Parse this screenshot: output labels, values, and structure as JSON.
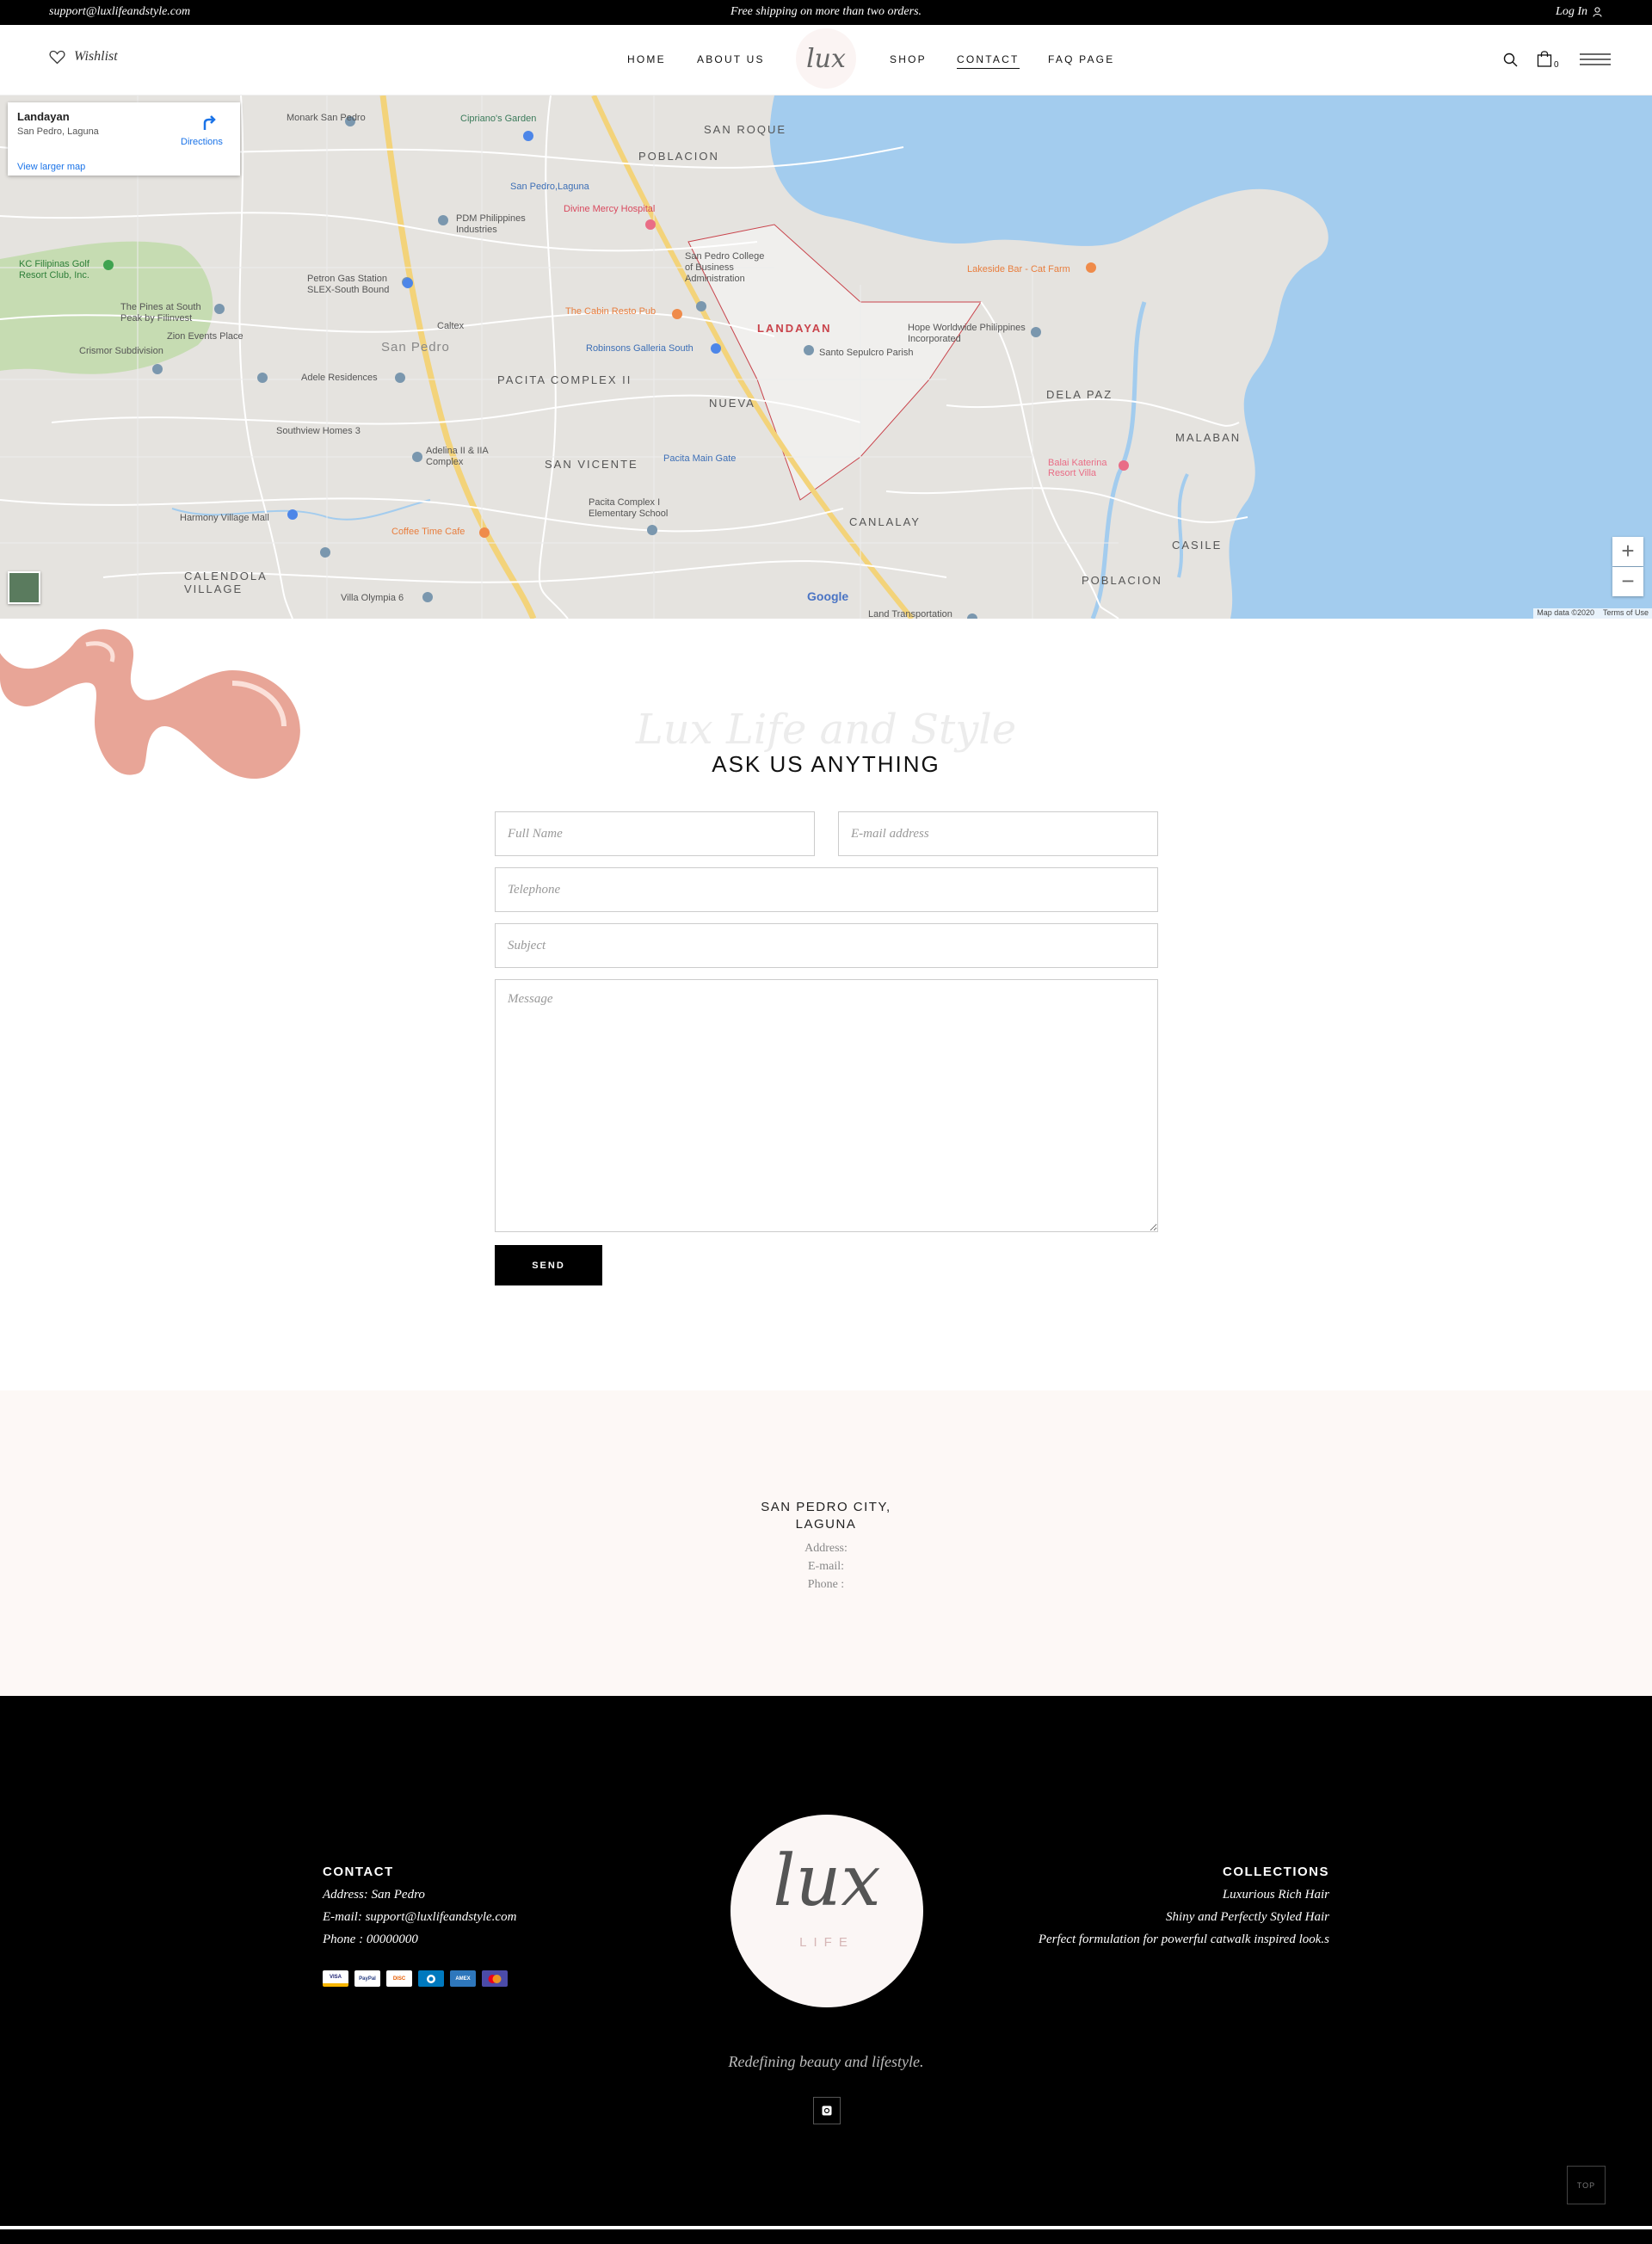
{
  "topbar": {
    "email": "support@luxlifeandstyle.com",
    "shipping": "Free shipping on more than two orders.",
    "login": "Log In"
  },
  "header": {
    "wishlist": "Wishlist",
    "nav_left": [
      "HOME",
      "ABOUT US"
    ],
    "logo": "lux",
    "nav_right": [
      "SHOP",
      "CONTACT",
      "FAQ PAGE"
    ],
    "active_nav": "CONTACT",
    "cart_count": "0"
  },
  "map": {
    "place_title": "Landayan",
    "place_subtitle": "San Pedro, Laguna",
    "larger_map": "View larger map",
    "directions": "Directions",
    "labels": [
      "SAN ROQUE",
      "POBLACION",
      "LANDAYAN",
      "PACITA COMPLEX II",
      "NUEVA",
      "SAN VICENTE",
      "DELA PAZ",
      "MALABAN",
      "CANLALAY",
      "CASILE",
      "POBLACION",
      "CALENDOLA VILLAGE",
      "San Pedro"
    ],
    "pois": [
      "Monark San Pedro",
      "Cipriano's Garden",
      "San Pedro,Laguna",
      "Divine Mercy Hospital",
      "PDM Philippines Industries",
      "San Pedro College of Business Administration",
      "Lakeside Bar - Cat Farm",
      "KC Filipinas Golf Resort Club, Inc.",
      "Petron Gas Station SLEX-South Bound",
      "Caltex",
      "The Pines at South Peak by Filinvest",
      "Zion Events Place",
      "Crismor Subdivision",
      "The Cabin Resto Pub",
      "Robinsons Galleria South",
      "Santo Sepulcro Parish",
      "Hope Worldwide Philippines Incorporated",
      "Adele Residences",
      "Southview Homes 3",
      "Adelina II & IIA Complex",
      "Pacita Main Gate",
      "Balai Katerina Resort Villa",
      "Harmony Village Mall",
      "Coffee Time Cafe",
      "Pacita Complex I Elementary School",
      "Villa Olympia 6",
      "Land Transportation"
    ],
    "attribution": "Map data ©2020",
    "terms": "Terms of Use",
    "google": "Google",
    "zoom_in": "+",
    "zoom_out": "−"
  },
  "form": {
    "script_title": "Lux Life and Style",
    "title": "ASK US ANYTHING",
    "placeholders": {
      "full_name": "Full Name",
      "email": "E-mail address",
      "telephone": "Telephone",
      "subject": "Subject",
      "message": "Message"
    },
    "send": "SEND"
  },
  "address": {
    "city": "SAN PEDRO CITY,\nLAGUNA",
    "city_line1": "SAN PEDRO CITY,",
    "city_line2": "LAGUNA",
    "address_label": "Address:",
    "email_label": "E-mail:",
    "phone_label": "Phone :"
  },
  "footer": {
    "contact_heading": "CONTACT",
    "contact_address": "Address: San Pedro",
    "contact_email": "E-mail: support@luxlifeandstyle.com",
    "contact_phone": "Phone : 00000000",
    "payment_cards": [
      "VISA",
      "PayPal",
      "DISCOVER",
      "Diners",
      "AMEX",
      "Mastercard"
    ],
    "logo_main": "lux",
    "logo_sub": "LIFE",
    "collections_heading": "COLLECTIONS",
    "collections": [
      "Luxurious Rich Hair",
      "Shiny and Perfectly Styled Hair",
      "Perfect formulation for powerful catwalk inspired look.s"
    ],
    "tagline": "Redefining beauty and lifestyle.",
    "to_top": "TOP"
  },
  "colors": {
    "black": "#000000",
    "blush": "#fdf8f6",
    "water": "#a3ccee",
    "accent_pink": "#e8a597"
  }
}
